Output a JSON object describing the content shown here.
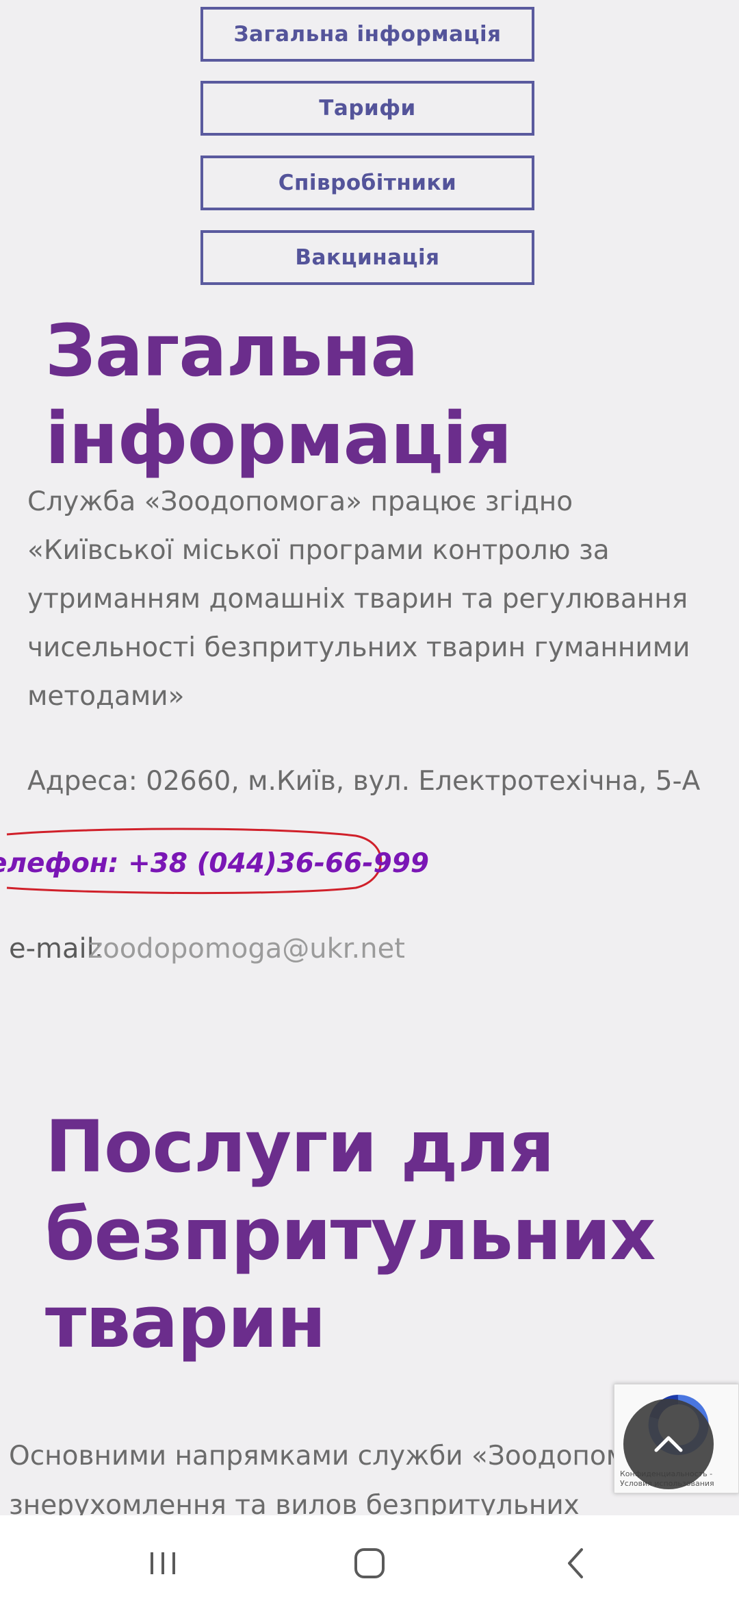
{
  "nav": {
    "general_info": "Загальна інформація",
    "tariffs": "Тарифи",
    "staff": "Співробітники",
    "vaccination": "Вакцинація"
  },
  "general": {
    "title_line1": "Загальна",
    "title_line2": "інформація",
    "description": "Служба «Зоодопомога» працює згідно «Київської міської програми контролю за утриманням домашніх тварин та регулювання чисельності безпритульних тварин гуманними методами»",
    "address": "Адреса: 02660, м.Київ, вул. Електротехічна, 5-А",
    "phone": "елефон: +38 (044)36-66-999",
    "email_label": "e-mail:",
    "email_value": "zoodopomoga@ukr.net"
  },
  "services": {
    "title_line1": "Послуги для",
    "title_line2": "безпритульних",
    "title_line3": "тварин",
    "text": "Основними напрямками служби «Зоодопомога» є знерухомлення та вилов безпритульних"
  },
  "recaptcha": {
    "text": "Конфиденциальность - Условия использования"
  },
  "colors": {
    "heading": "#6b2d8c",
    "nav_border": "#5a5a9e",
    "phone": "#7a16b5",
    "highlight_ring": "#d0202a"
  }
}
